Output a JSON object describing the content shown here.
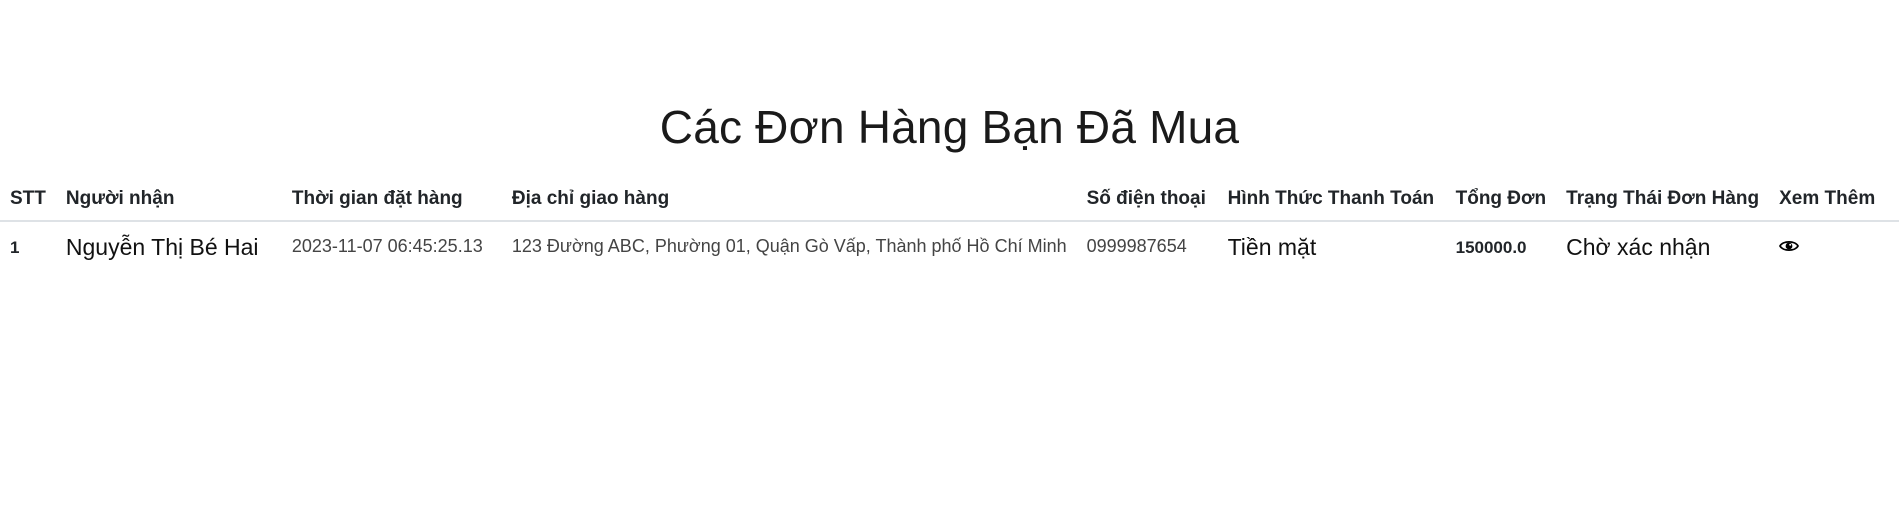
{
  "page": {
    "title": "Các Đơn Hàng Bạn Đã Mua"
  },
  "table": {
    "headers": {
      "stt": "STT",
      "recipient": "Người nhận",
      "order_time": "Thời gian đặt hàng",
      "address": "Địa chỉ giao hàng",
      "phone": "Số điện thoại",
      "payment": "Hình Thức Thanh Toán",
      "total": "Tổng Đơn",
      "status": "Trạng Thái Đơn Hàng",
      "view_more": "Xem Thêm"
    },
    "rows": [
      {
        "stt": "1",
        "recipient": "Nguyễn Thị Bé Hai",
        "order_time": "2023-11-07 06:45:25.13",
        "address": "123 Đường ABC, Phường 01, Quận Gò Vấp, Thành phố Hồ Chí Minh",
        "phone": "0999987654",
        "payment": "Tiền mặt",
        "total": "150000.0",
        "status": "Chờ xác nhận",
        "view_icon": "eye-icon"
      }
    ]
  }
}
